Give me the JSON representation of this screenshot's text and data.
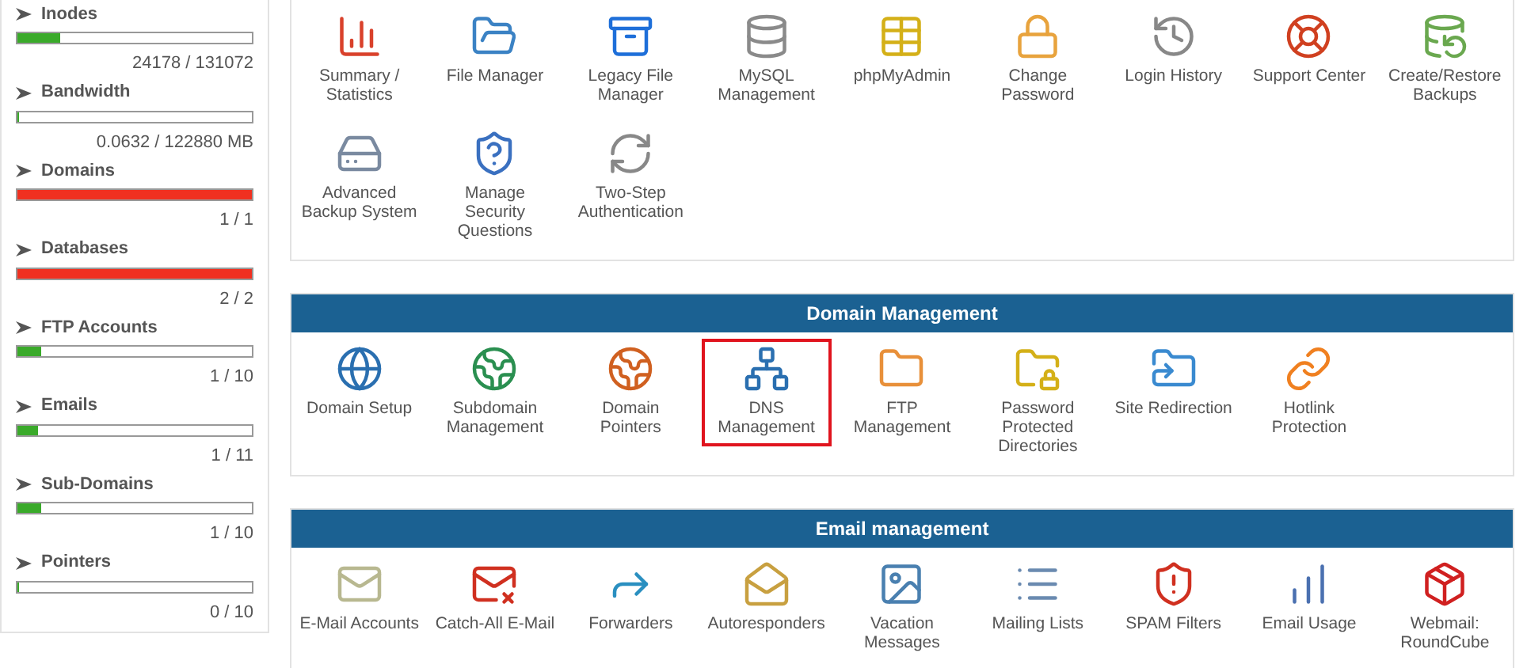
{
  "sidebar": {
    "stats": [
      {
        "label": "Inodes",
        "level": 0.18,
        "reading": "24178 / 131072"
      },
      {
        "label": "Bandwidth",
        "level": 0,
        "reading": "0.0632 / 122880 MB"
      },
      {
        "label": "Domains",
        "level": 1,
        "reading": "1 / 1"
      },
      {
        "label": "Databases",
        "level": 1,
        "reading": "2 / 2"
      },
      {
        "label": "FTP Accounts",
        "level": 0.1,
        "reading": "1 / 10"
      },
      {
        "label": "Emails",
        "level": 0.09,
        "reading": "1 / 11"
      },
      {
        "label": "Sub-Domains",
        "level": 0.1,
        "reading": "1 / 10"
      },
      {
        "label": "Pointers",
        "level": 0,
        "reading": "0 / 10"
      }
    ]
  },
  "sections": [
    {
      "items": [
        {
          "label": "Summary / Statistics",
          "highlighted": false
        },
        {
          "label": "File Manager",
          "highlighted": false
        },
        {
          "label": "Legacy File Manager",
          "highlighted": false
        },
        {
          "label": "MySQL Management",
          "highlighted": false
        },
        {
          "label": "phpMyAdmin",
          "highlighted": false
        },
        {
          "label": "Change Password",
          "highlighted": false
        },
        {
          "label": "Login History",
          "highlighted": false
        },
        {
          "label": "Support Center",
          "highlighted": false
        },
        {
          "label": "Create/Restore Backups",
          "highlighted": false
        },
        {
          "label": "Advanced Backup System",
          "highlighted": false
        },
        {
          "label": "Manage Security Questions",
          "highlighted": false
        },
        {
          "label": "Two-Step Authentication",
          "highlighted": false
        }
      ]
    },
    {
      "title": "Domain Management",
      "items": [
        {
          "label": "Domain Setup",
          "highlighted": false
        },
        {
          "label": "Subdomain Management",
          "highlighted": false
        },
        {
          "label": "Domain Pointers",
          "highlighted": false
        },
        {
          "label": "DNS Management",
          "highlighted": true
        },
        {
          "label": "FTP Management",
          "highlighted": false
        },
        {
          "label": "Password Protected Directories",
          "highlighted": false
        },
        {
          "label": "Site Redirection",
          "highlighted": false
        },
        {
          "label": "Hotlink Protection",
          "highlighted": false
        }
      ]
    },
    {
      "title": "Email management",
      "items": [
        {
          "label": "E-Mail Accounts",
          "highlighted": false
        },
        {
          "label": "Catch-All E-Mail",
          "highlighted": false
        },
        {
          "label": "Forwarders",
          "highlighted": false
        },
        {
          "label": "Autoresponders",
          "highlighted": false
        },
        {
          "label": "Vacation Messages",
          "highlighted": false
        },
        {
          "label": "Mailing Lists",
          "highlighted": false
        },
        {
          "label": "SPAM Filters",
          "highlighted": false
        },
        {
          "label": "Email Usage",
          "highlighted": false
        },
        {
          "label": "Webmail: RoundCube",
          "highlighted": false
        }
      ]
    }
  ]
}
